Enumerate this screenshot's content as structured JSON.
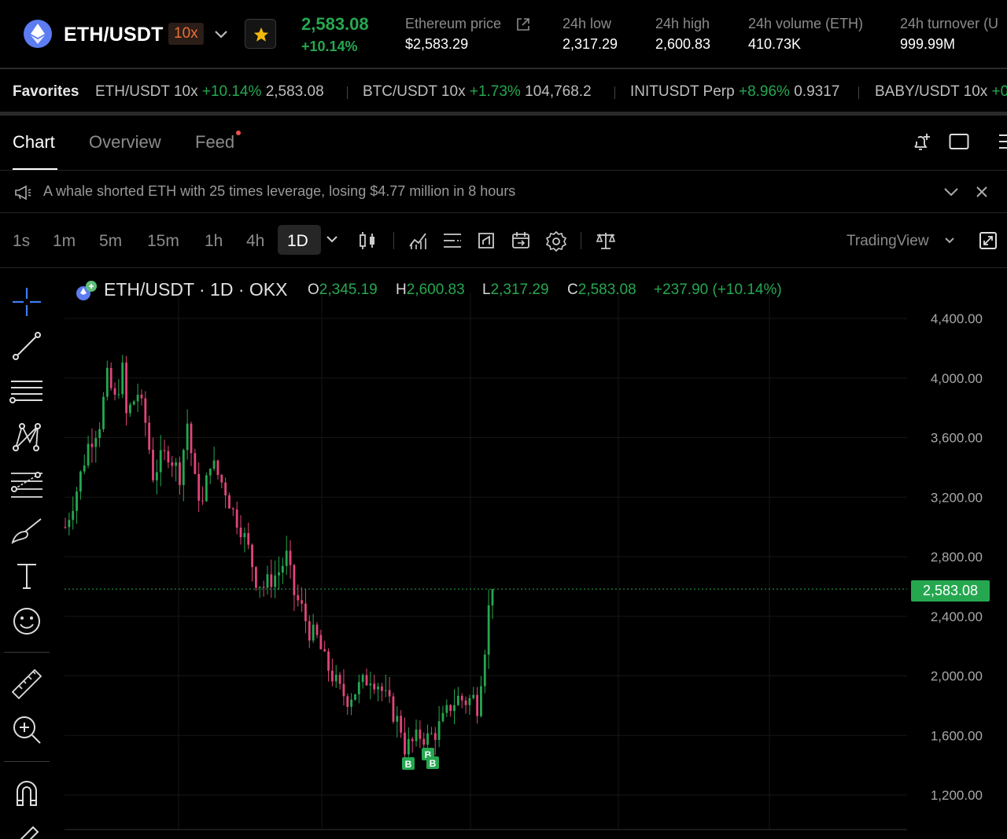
{
  "header": {
    "pair": "ETH/USDT",
    "leverage": "10x",
    "last_price": "2,583.08",
    "change_pct": "+10.14%",
    "stats": [
      {
        "label": "Ethereum price",
        "value": "$2,583.29"
      },
      {
        "label": "24h low",
        "value": "2,317.29"
      },
      {
        "label": "24h high",
        "value": "2,600.83"
      },
      {
        "label": "24h volume (ETH)",
        "value": "410.73K"
      },
      {
        "label": "24h turnover (U",
        "value": "999.99M"
      }
    ]
  },
  "favorites": {
    "label": "Favorites",
    "items": [
      {
        "symbol": "ETH/USDT 10x",
        "change": "+10.14%",
        "price": "2,583.08"
      },
      {
        "symbol": "BTC/USDT 10x",
        "change": "+1.73%",
        "price": "104,768.2"
      },
      {
        "symbol": "INITUSDT Perp",
        "change": "+8.96%",
        "price": "0.9317"
      },
      {
        "symbol": "BABY/USDT 10x",
        "change": "+0",
        "price": ""
      }
    ]
  },
  "tabs": [
    "Chart",
    "Overview",
    "Feed"
  ],
  "announcement": "A whale shorted ETH with 25 times leverage, losing $4.77 million in 8 hours",
  "toolbar": {
    "timeframes": [
      "1s",
      "1m",
      "5m",
      "15m",
      "1h",
      "4h",
      "1D"
    ],
    "active_timeframe": "1D",
    "provider": "TradingView"
  },
  "icons": {
    "header": [
      "ethereum-icon",
      "chevron-down-icon",
      "star-icon",
      "external-link-icon"
    ],
    "tabs": [
      "bell-plus-icon",
      "square-icon",
      "menu-icon"
    ],
    "announcement": [
      "megaphone-icon",
      "chevron-down-icon",
      "close-icon"
    ],
    "toolbar": [
      "candles-icon",
      "indicators-icon",
      "list-icon",
      "replay-icon",
      "calendar-icon",
      "gear-icon",
      "scale-icon",
      "chevron-down-icon",
      "fullscreen-icon"
    ],
    "drawing": [
      "crosshair-icon",
      "trend-line-icon",
      "horizontal-lines-icon",
      "pattern-icon",
      "forecast-icon",
      "brush-icon",
      "text-icon",
      "emoji-icon",
      "ruler-icon",
      "zoom-in-icon",
      "magnet-icon",
      "pencil-icon"
    ]
  },
  "colors": {
    "up": "#25a750",
    "down": "#e0457b",
    "accent": "#e7703a",
    "star": "#f0b90b"
  },
  "chart_data": {
    "type": "candlestick",
    "symbol": "ETH/USDT",
    "interval": "1D",
    "exchange": "OKX",
    "ohlc": {
      "open": "2,345.19",
      "high": "2,600.83",
      "low": "2,317.29",
      "close": "2,583.08",
      "change": "+237.90 (+10.14%)"
    },
    "price_axis": [
      "4,400.00",
      "4,000.00",
      "3,600.00",
      "3,200.00",
      "2,800.00",
      "2,400.00",
      "2,000.00",
      "1,600.00",
      "1,200.00"
    ],
    "current_price_label": "2,583.08",
    "current_price": 2583.08,
    "ylim": [
      1200,
      4400
    ],
    "buy_markers": [
      "B",
      "B",
      "B"
    ],
    "path": [
      [
        0,
        3000
      ],
      [
        3,
        3250
      ],
      [
        6,
        3550
      ],
      [
        9,
        3700
      ],
      [
        11,
        4000
      ],
      [
        13,
        3850
      ],
      [
        15,
        4050
      ],
      [
        16,
        3750
      ],
      [
        19,
        3900
      ],
      [
        21,
        3700
      ],
      [
        23,
        3350
      ],
      [
        25,
        3450
      ],
      [
        27,
        3500
      ],
      [
        30,
        3350
      ],
      [
        32,
        3700
      ],
      [
        34,
        3300
      ],
      [
        36,
        3150
      ],
      [
        38,
        3450
      ],
      [
        40,
        3350
      ],
      [
        42,
        3250
      ],
      [
        44,
        3100
      ],
      [
        46,
        3000
      ],
      [
        48,
        2850
      ],
      [
        50,
        2650
      ],
      [
        52,
        2600
      ],
      [
        54,
        2650
      ],
      [
        56,
        2700
      ],
      [
        58,
        2800
      ],
      [
        60,
        2550
      ],
      [
        62,
        2450
      ],
      [
        64,
        2300
      ],
      [
        66,
        2250
      ],
      [
        68,
        2100
      ],
      [
        70,
        2000
      ],
      [
        72,
        1900
      ],
      [
        74,
        1850
      ],
      [
        76,
        1900
      ],
      [
        78,
        1950
      ],
      [
        80,
        2000
      ],
      [
        82,
        1950
      ],
      [
        84,
        1850
      ],
      [
        86,
        1750
      ],
      [
        88,
        1650
      ],
      [
        89,
        1520
      ],
      [
        91,
        1550
      ],
      [
        93,
        1600
      ],
      [
        95,
        1580
      ],
      [
        97,
        1620
      ],
      [
        99,
        1700
      ],
      [
        101,
        1800
      ],
      [
        103,
        1850
      ],
      [
        105,
        1830
      ],
      [
        107,
        1850
      ],
      [
        108,
        1800
      ],
      [
        109,
        2000
      ],
      [
        110,
        2200
      ],
      [
        111,
        2450
      ],
      [
        112,
        2583
      ]
    ]
  }
}
